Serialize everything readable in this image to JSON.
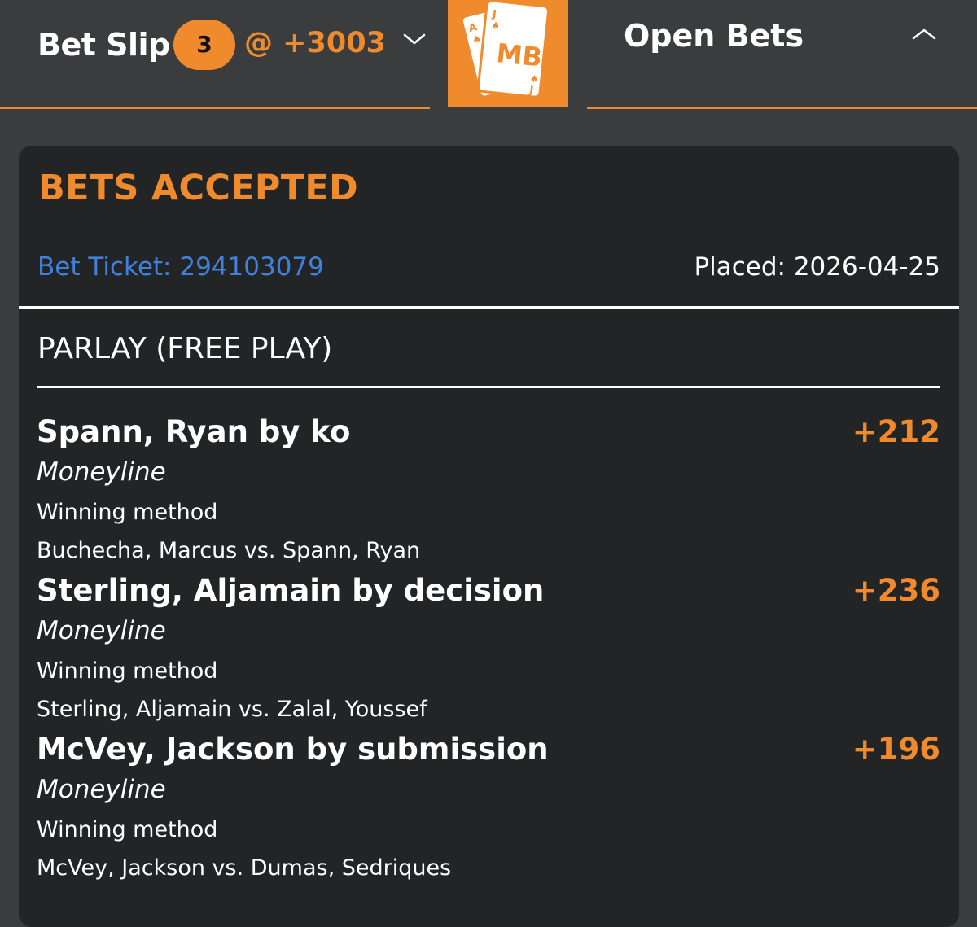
{
  "header": {
    "bet_slip_label": "Bet Slip",
    "bet_count": "3",
    "combined_odds": "@ +3003",
    "open_bets_label": "Open Bets",
    "logo_text": "MB",
    "accent_color": "#ef8b2c"
  },
  "confirmation": {
    "title": "BETS ACCEPTED",
    "ticket": "Bet Ticket: 294103079",
    "placed": "Placed: 2026-04-25",
    "bet_type": "PARLAY (FREE PLAY)"
  },
  "legs": [
    {
      "pick": "Spann, Ryan by ko",
      "odds": "+212",
      "market": "Moneyline",
      "method": "Winning method",
      "matchup": "Buchecha, Marcus vs. Spann, Ryan"
    },
    {
      "pick": "Sterling, Aljamain by decision",
      "odds": "+236",
      "market": "Moneyline",
      "method": "Winning method",
      "matchup": "Sterling, Aljamain vs. Zalal, Youssef"
    },
    {
      "pick": "McVey, Jackson by submission",
      "odds": "+196",
      "market": "Moneyline",
      "method": "Winning method",
      "matchup": "McVey, Jackson vs. Dumas, Sedriques"
    }
  ]
}
